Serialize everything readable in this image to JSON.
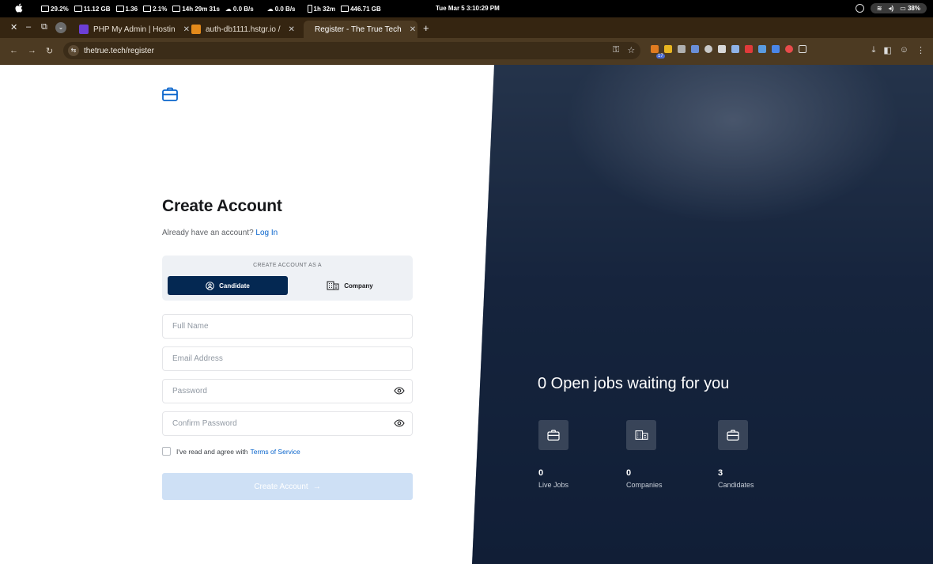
{
  "menubar": {
    "stats": [
      "29.2%",
      "11.12 GB",
      "1.36",
      "2.1%",
      "14h 29m 31s",
      "0.0 B/s",
      "0.0 B/s",
      "1h 32m",
      "446.71 GB"
    ],
    "clock": "Tue Mar 5  3:10:29 PM",
    "battery": "38%"
  },
  "tabs": [
    {
      "label": "PHP My Admin | Hostin",
      "active": false
    },
    {
      "label": "auth-db1111.hstgr.io / ",
      "active": false
    },
    {
      "label": "Register - The True Tech",
      "active": true
    }
  ],
  "address": {
    "url": "thetrue.tech/register"
  },
  "extensions": {
    "badge": "17"
  },
  "form": {
    "title": "Create Account",
    "have_account": "Already have an account?",
    "login_link": "Log In",
    "role_caption": "CREATE ACCOUNT AS A",
    "role_candidate": "Candidate",
    "role_company": "Company",
    "full_name_placeholder": "Full Name",
    "email_placeholder": "Email Address",
    "password_placeholder": "Password",
    "confirm_password_placeholder": "Confirm Password",
    "agree_text": "I've read and agree with",
    "terms_link": "Terms of Service",
    "submit_label": "Create Account",
    "submit_arrow": "→"
  },
  "hero": {
    "headline": "0 Open jobs waiting for you",
    "stats": [
      {
        "value": "0",
        "label": "Live Jobs",
        "icon": "briefcase-icon"
      },
      {
        "value": "0",
        "label": "Companies",
        "icon": "building-icon"
      },
      {
        "value": "3",
        "label": "Candidates",
        "icon": "briefcase-icon"
      }
    ]
  },
  "colors": {
    "primary": "#042852",
    "link": "#0a65cc",
    "button_disabled": "#cee0f5"
  }
}
